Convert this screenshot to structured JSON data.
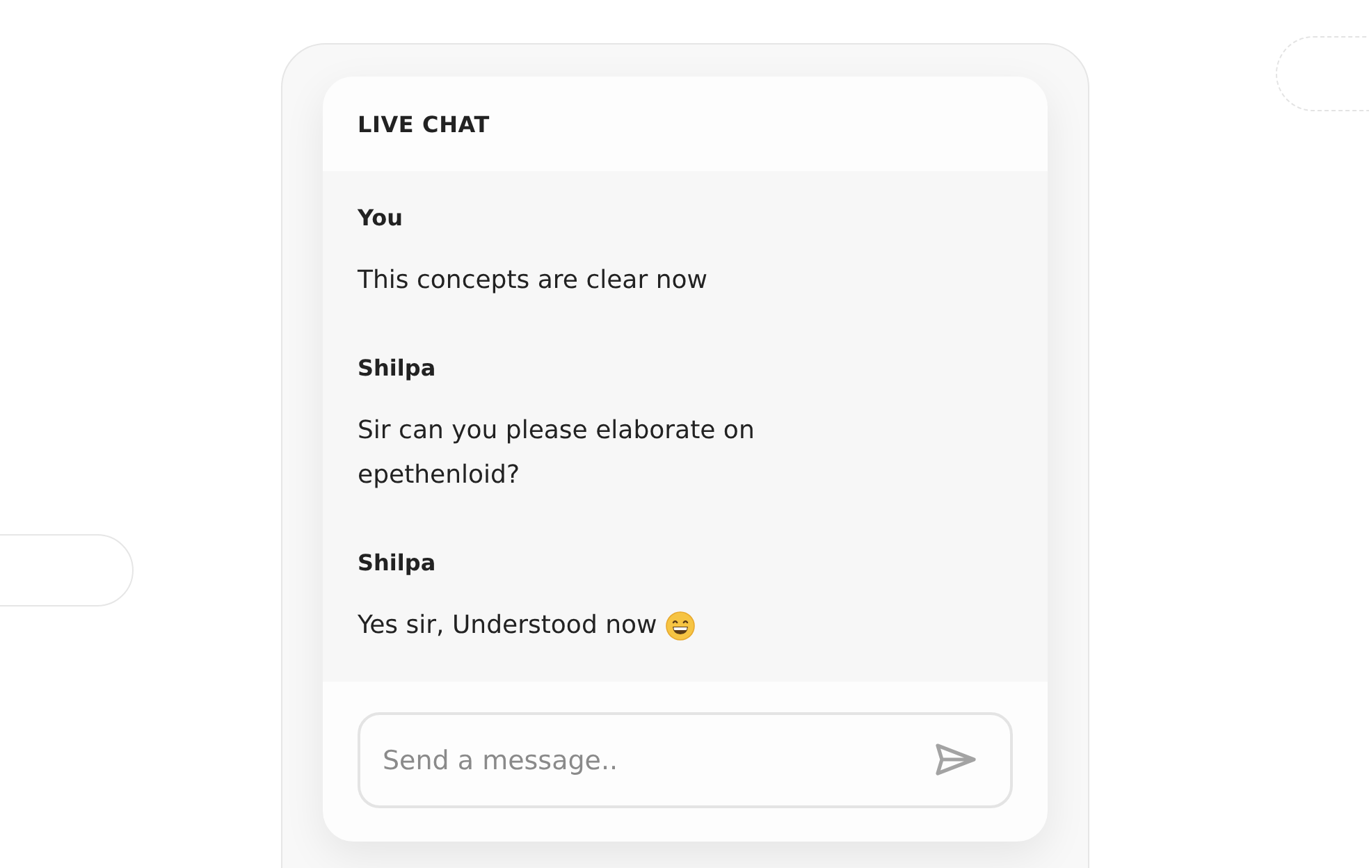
{
  "chat": {
    "title": "LIVE CHAT",
    "messages": [
      {
        "sender": "You",
        "text": "This concepts are clear now",
        "emoji": false
      },
      {
        "sender": "Shilpa",
        "text": "Sir can you please elaborate on epethenloid?",
        "emoji": false
      },
      {
        "sender": "Shilpa",
        "text": "Yes sir, Understood now",
        "emoji": true
      }
    ],
    "input": {
      "placeholder": "Send a message.."
    }
  }
}
